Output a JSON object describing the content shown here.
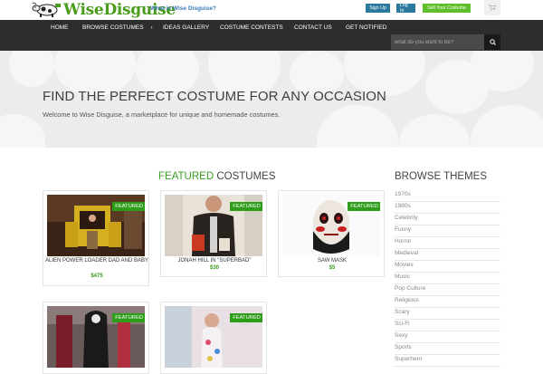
{
  "header": {
    "logo_text": "WiseDisguise",
    "what_link": "What is Wise Disguise?",
    "sign_up": "Sign Up",
    "log_in": "Log In",
    "sell": "Sell Your Costume"
  },
  "nav": {
    "items": [
      "HOME",
      "BROWSE COSTUMES",
      "IDEAS GALLERY",
      "COSTUME CONTESTS",
      "CONTACT US",
      "GET NOTIFIED"
    ],
    "search_placeholder": "what do you want to be?"
  },
  "hero": {
    "title": "FIND THE PERFECT COSTUME FOR ANY OCCASION",
    "subtitle": "Welcome to Wise Disguise, a marketplace for unique and homemade costumes."
  },
  "featured": {
    "title_accent": "FEATURED",
    "title_rest": " COSTUMES",
    "badge": "FEATURED",
    "cards": [
      {
        "name": "ALIEN POWER LOADER DAD AND BABY",
        "price": "$475"
      },
      {
        "name": "JONAH HILL IN \"SUPERBAD\"",
        "price": "$30"
      },
      {
        "name": "SAW MASK",
        "price": "$5"
      },
      {
        "name": "",
        "price": ""
      },
      {
        "name": "",
        "price": ""
      }
    ]
  },
  "themes": {
    "title": "BROWSE THEMES",
    "items": [
      "1970s",
      "1980s",
      "Celebrity",
      "Funny",
      "Horror",
      "Medieval",
      "Movies",
      "Music",
      "Pop Culture",
      "Religious",
      "Scary",
      "Sci-Fi",
      "Sexy",
      "Sports",
      "Superhero"
    ]
  },
  "colors": {
    "accent_green": "#3aa020",
    "nav_bg": "#2d2d2d",
    "button_blue": "#2b7a9e"
  }
}
